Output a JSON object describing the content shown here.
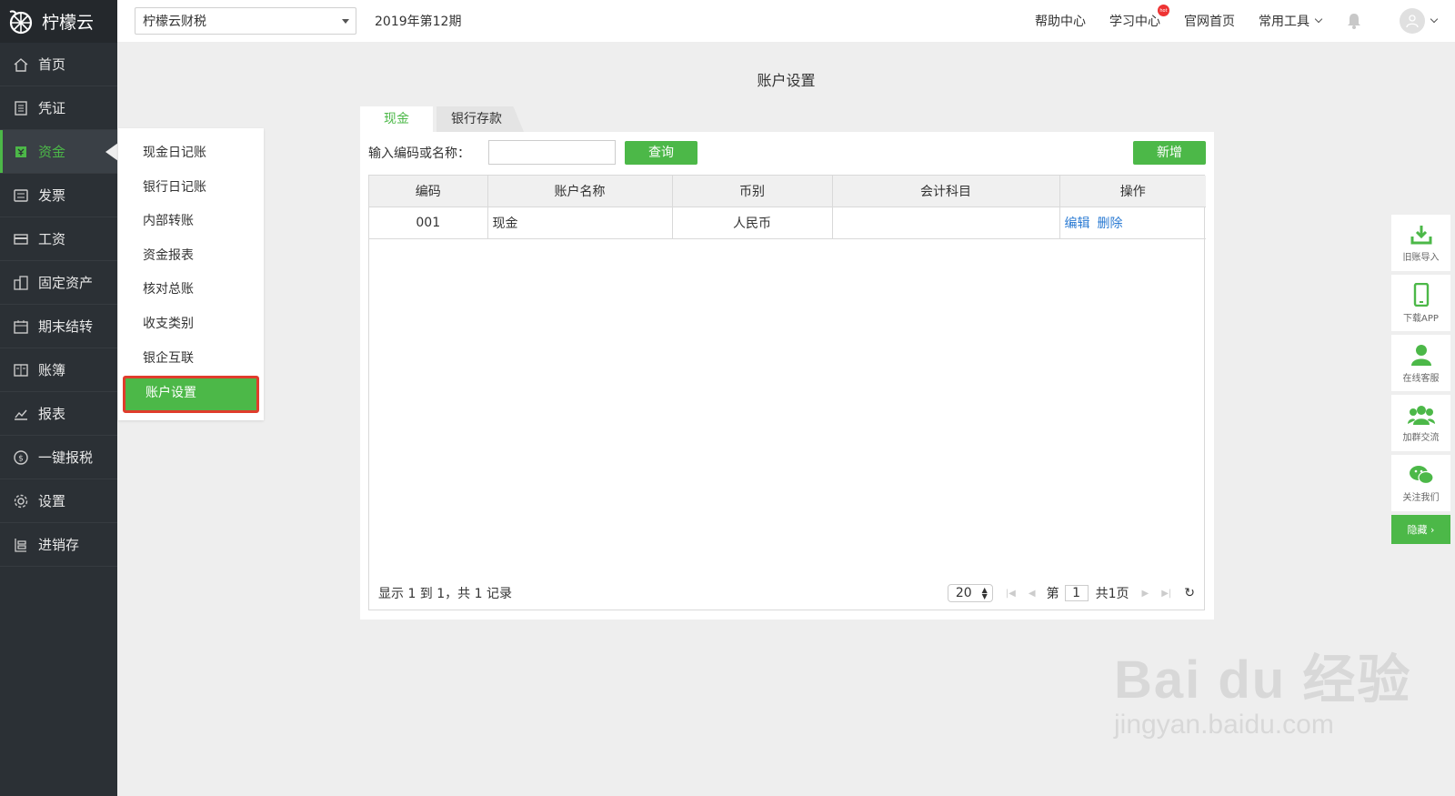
{
  "app": {
    "logo_text": "柠檬云"
  },
  "sidebar": {
    "items": [
      {
        "label": "首页",
        "icon": "home-icon"
      },
      {
        "label": "凭证",
        "icon": "voucher-icon"
      },
      {
        "label": "资金",
        "icon": "fund-icon",
        "active": true
      },
      {
        "label": "发票",
        "icon": "invoice-icon"
      },
      {
        "label": "工资",
        "icon": "salary-icon"
      },
      {
        "label": "固定资产",
        "icon": "fixed-asset-icon"
      },
      {
        "label": "期末结转",
        "icon": "calendar-icon"
      },
      {
        "label": "账簿",
        "icon": "ledger-icon"
      },
      {
        "label": "报表",
        "icon": "report-icon"
      },
      {
        "label": "一键报税",
        "icon": "tax-icon"
      },
      {
        "label": "设置",
        "icon": "gear-icon"
      },
      {
        "label": "进销存",
        "icon": "inventory-icon"
      }
    ]
  },
  "topbar": {
    "company": "柠檬云财税",
    "period": "2019年第12期",
    "links": {
      "help": "帮助中心",
      "learn": "学习中心",
      "official": "官网首页",
      "tools": "常用工具"
    },
    "hot_badge": "hot"
  },
  "submenu": {
    "items": [
      "现金日记账",
      "银行日记账",
      "内部转账",
      "资金报表",
      "核对总账",
      "收支类别",
      "银企互联",
      "账户设置"
    ],
    "active_index": 7
  },
  "page": {
    "title": "账户设置"
  },
  "tabs": [
    "现金",
    "银行存款"
  ],
  "search": {
    "label": "输入编码或名称：",
    "value": "",
    "query_button": "查询",
    "add_button": "新增"
  },
  "table": {
    "headers": [
      "编码",
      "账户名称",
      "币别",
      "会计科目",
      "操作"
    ],
    "rows": [
      {
        "code": "001",
        "name": "现金",
        "currency": "人民币",
        "subject": "",
        "edit": "编辑",
        "delete": "删除"
      }
    ]
  },
  "pager": {
    "info": "显示 1 到 1，共 1 记录",
    "page_size": "20",
    "page_prefix": "第",
    "page_current": "1",
    "page_total": "共1页"
  },
  "float_bar": {
    "items": [
      "旧账导入",
      "下载APP",
      "在线客服",
      "加群交流",
      "关注我们"
    ],
    "hide": "隐藏 ›"
  },
  "watermark": {
    "line1": "Bai du 经验",
    "line2": "jingyan.baidu.com"
  },
  "colors": {
    "accent": "#4cb848",
    "sidebar_bg": "#2b3035",
    "link": "#2b7bd3",
    "highlight_border": "#e03c2c"
  }
}
